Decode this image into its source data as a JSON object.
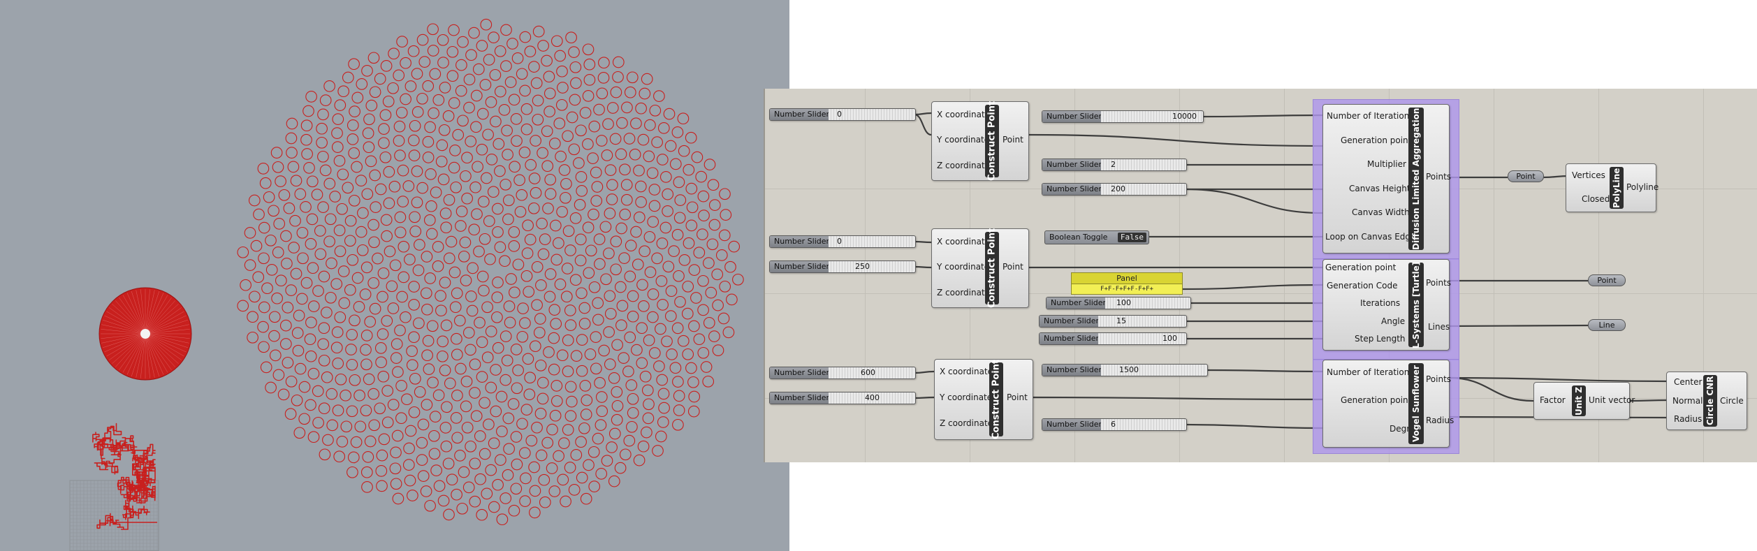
{
  "viewport": {
    "background": "#9ca3ab",
    "geometry_color": "#c8201e",
    "panels": [
      "phyllotaxis-vogel-sunflower",
      "dla-spiral-disc",
      "l-system-dla-aggregate"
    ]
  },
  "canvas": {
    "group_color": "#b496ec",
    "components": {
      "construct_point_1": {
        "title": "Construct Point",
        "inputs": [
          "X coordinate",
          "Y coordinate",
          "Z coordinate"
        ],
        "output": "Point"
      },
      "construct_point_2": {
        "title": "Construct Point",
        "inputs": [
          "X coordinate",
          "Y coordinate",
          "Z coordinate"
        ],
        "output": "Point"
      },
      "construct_point_3": {
        "title": "Construct Point",
        "inputs": [
          "X coordinate",
          "Y coordinate",
          "Z coordinate"
        ],
        "output": "Point"
      },
      "dla": {
        "title": "Diffusion Limited Aggregation",
        "inputs": [
          "Number of Iterations",
          "Generation point",
          "Multiplier",
          "Canvas Height",
          "Canvas Width",
          "Loop on Canvas Edge"
        ],
        "output": "Points"
      },
      "lsystem": {
        "title": "L-Systems [Turtle]",
        "inputs": [
          "Generation point",
          "Generation Code",
          "Iterations",
          "Angle",
          "Step Length"
        ],
        "outputs": [
          "Points",
          "Lines"
        ]
      },
      "vogel": {
        "title": "Vogel Sunflower",
        "inputs": [
          "Number of Iterations",
          "Generation point",
          "Degree"
        ],
        "outputs": [
          "Points",
          "Radius"
        ]
      },
      "polyline": {
        "title": "PolyLine",
        "inputs": [
          "Vertices",
          "Closed"
        ],
        "output": "Polyline"
      },
      "unit_z": {
        "title": "Unit Z",
        "input": "Factor",
        "output": "Unit vector"
      },
      "circle_cnr": {
        "title": "Circle CNR",
        "inputs": [
          "Center",
          "Normal",
          "Radius"
        ],
        "output": "Circle"
      }
    },
    "sliders": [
      {
        "label": "Number Slider",
        "value": "0"
      },
      {
        "label": "Number Slider",
        "value": "10000"
      },
      {
        "label": "Number Slider",
        "value": "2"
      },
      {
        "label": "Number Slider",
        "value": "200"
      },
      {
        "label": "Number Slider",
        "value": "0"
      },
      {
        "label": "Number Slider",
        "value": "250"
      },
      {
        "label": "Number Slider",
        "value": "100"
      },
      {
        "label": "Number Slider",
        "value": "15"
      },
      {
        "label": "Number Slider",
        "value": "100"
      },
      {
        "label": "Number Slider",
        "value": "600"
      },
      {
        "label": "Number Slider",
        "value": "400"
      },
      {
        "label": "Number Slider",
        "value": "1500"
      },
      {
        "label": "Number Slider",
        "value": "6"
      }
    ],
    "toggle": {
      "label": "Boolean Toggle",
      "value": "False"
    },
    "panel": {
      "title": "Panel",
      "content": "F+F-F+F+F-F+F+"
    },
    "params": {
      "point_a": "Point",
      "point_b": "Point",
      "line": "Line"
    }
  }
}
